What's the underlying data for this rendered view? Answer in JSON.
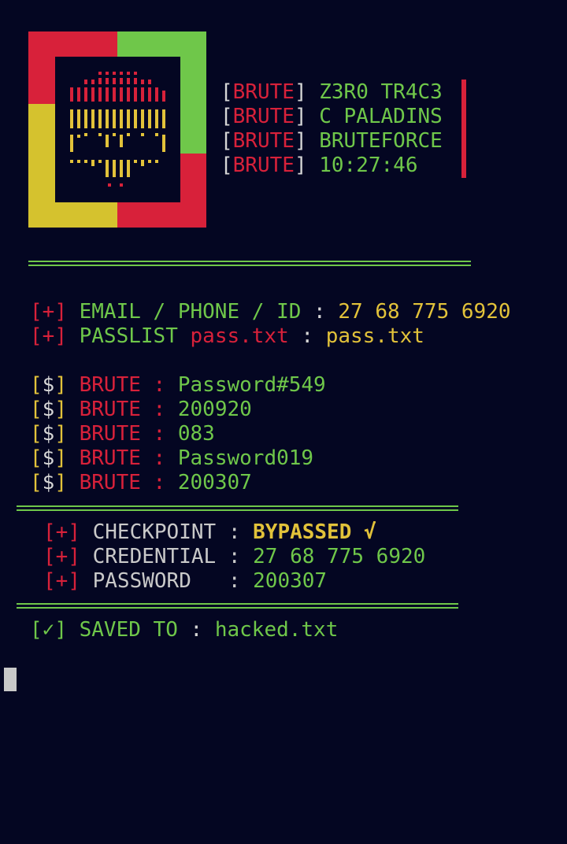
{
  "colors": {
    "background": "#040622",
    "red": "#d8213a",
    "green": "#6fc74a",
    "yellow": "#e2c23a"
  },
  "banner": {
    "logo_icon": "skull-ascii-icon",
    "lines": [
      {
        "tag": "BRUTE",
        "value": "Z3R0 TR4C3"
      },
      {
        "tag": "BRUTE",
        "value": "C PALADINS"
      },
      {
        "tag": "BRUTE",
        "value": "BRUTEFORCE"
      },
      {
        "tag": "BRUTE",
        "value": "10:27:46"
      }
    ]
  },
  "inputs": {
    "marker": "+",
    "id_label": "EMAIL / PHONE / ID",
    "id_value": "27 68 775 6920",
    "passlist_label": "PASSLIST",
    "passlist_file_red": "pass.txt",
    "passlist_value": "pass.txt",
    "separator": ":"
  },
  "attempts": {
    "marker": "$",
    "label": "BRUTE",
    "items": [
      "Password#549",
      "200920",
      "083",
      "Password019",
      "200307"
    ]
  },
  "result": {
    "marker": "+",
    "checkpoint_label": "CHECKPOINT",
    "checkpoint_value": "BYPASSED √",
    "credential_label": "CREDENTIAL",
    "credential_value": "27 68 775 6920",
    "password_label": "PASSWORD",
    "password_value": "200307"
  },
  "saved": {
    "marker": "✓",
    "label": "SAVED TO",
    "file": "hacked.txt"
  }
}
